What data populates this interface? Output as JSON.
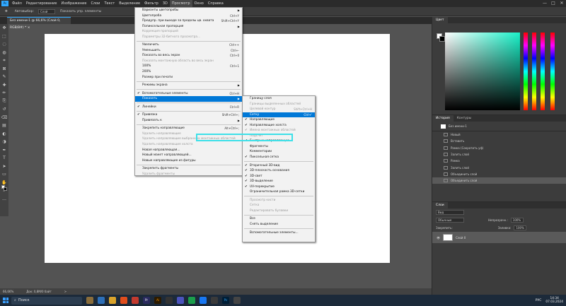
{
  "app": {
    "menubar": [
      "Файл",
      "Редактирование",
      "Изображение",
      "Слои",
      "Текст",
      "Выделение",
      "Фильтр",
      "3D",
      "Просмотр",
      "Окно",
      "Справка"
    ],
    "active_menu_index": 8,
    "window_controls": [
      "—",
      "□",
      "✕"
    ]
  },
  "options_bar": {
    "tool_label": "Автовыбор:",
    "select_value": "Слой",
    "show_controls": "Показать упр. элементы"
  },
  "document_tab": "Без имени-1 @ 66,6% (Слой 0, RGB/8#) * ×",
  "status_bar": {
    "zoom": "66,66%",
    "doc": "Док: 0,8М/0 байт",
    "arrow": ">"
  },
  "toolbar_icons": [
    "move-icon",
    "marquee-icon",
    "lasso-icon",
    "quick-select-icon",
    "crop-icon",
    "frame-icon",
    "eyedropper-icon",
    "healing-icon",
    "brush-icon",
    "stamp-icon",
    "history-brush-icon",
    "eraser-icon",
    "gradient-icon",
    "blur-icon",
    "dodge-icon",
    "pen-icon",
    "type-icon",
    "path-select-icon",
    "rectangle-icon",
    "hand-icon",
    "zoom-icon",
    "more-icon"
  ],
  "main_menu": [
    {
      "label": "Варианты цветопробы",
      "arrow": true
    },
    {
      "label": "Цветопроба",
      "shortcut": "Ctrl+Y"
    },
    {
      "label": "Предупр. при выходе за пределы цв. охвата",
      "shortcut": "Shift+Ctrl+Y"
    },
    {
      "label": "Попиксельная пропорция",
      "arrow": true
    },
    {
      "label": "Коррекция пропорций",
      "disabled": true
    },
    {
      "label": "Параметры 32-битного просмотра...",
      "disabled": true
    },
    {
      "sep": true
    },
    {
      "label": "Увеличить",
      "shortcut": "Ctrl++"
    },
    {
      "label": "Уменьшить",
      "shortcut": "Ctrl+-"
    },
    {
      "label": "Показать во весь экран",
      "shortcut": "Ctrl+0"
    },
    {
      "label": "Показать монтажную область во весь экран",
      "disabled": true
    },
    {
      "label": "100%",
      "shortcut": "Ctrl+1"
    },
    {
      "label": "200%"
    },
    {
      "label": "Размер при печати"
    },
    {
      "sep": true
    },
    {
      "label": "Режимы экрана",
      "arrow": true
    },
    {
      "sep": true
    },
    {
      "label": "Вспомогательные элементы",
      "shortcut": "Ctrl+H",
      "check": true
    },
    {
      "label": "Показать",
      "arrow": true,
      "highlight": true
    },
    {
      "sep": true
    },
    {
      "label": "Линейки",
      "shortcut": "Ctrl+R",
      "check": true
    },
    {
      "sep": true
    },
    {
      "label": "Привязка",
      "shortcut": "Shift+Ctrl+;",
      "check": true
    },
    {
      "label": "Привязать к",
      "arrow": true
    },
    {
      "sep": true
    },
    {
      "label": "Закрепить направляющие",
      "shortcut": "Alt+Ctrl+;"
    },
    {
      "label": "Удалить направляющие",
      "disabled": true
    },
    {
      "label": "Удалить направляющие выбранных монтажных областей",
      "disabled": true
    },
    {
      "label": "Удалить направляющие холста",
      "disabled": true
    },
    {
      "label": "Новая направляющая..."
    },
    {
      "label": "Новый макет направляющей..."
    },
    {
      "label": "Новые направляющие из фигуры"
    },
    {
      "sep": true
    },
    {
      "label": "Закрепить фрагменты"
    },
    {
      "label": "Удалить фрагменты",
      "disabled": true
    }
  ],
  "sub_menu": [
    {
      "label": "Границу слоя"
    },
    {
      "label": "Границы выделенных областей",
      "disabled": true
    },
    {
      "label": "Целевой контур",
      "shortcut": "Shift+Ctrl+H",
      "disabled": true
    },
    {
      "label": "Сетку",
      "shortcut": "Ctrl+'",
      "highlight": true
    },
    {
      "label": "Направляющие",
      "check": true
    },
    {
      "label": "Направляющие холста",
      "check": true
    },
    {
      "label": "Имена монтажных областей",
      "check": true,
      "disabled": true
    },
    {
      "label": "Подсчет",
      "disabled": true
    },
    {
      "label": "Быстрые направляющие",
      "check": true
    },
    {
      "label": "Фрагменты"
    },
    {
      "label": "Комментарии"
    },
    {
      "label": "Пиксельная сетка",
      "check": true
    },
    {
      "sep": true
    },
    {
      "label": "Вторичный 3D-вид",
      "check": true
    },
    {
      "label": "3D-плоскость основания",
      "check": true
    },
    {
      "label": "3D-свет",
      "check": true
    },
    {
      "label": "3D-выделение",
      "check": true
    },
    {
      "label": "UV-перекрытие",
      "check": true
    },
    {
      "label": "Ограничительная рамка 3D-сетки"
    },
    {
      "sep": true
    },
    {
      "label": "Просмотр кисти",
      "disabled": true
    },
    {
      "label": "Сетка",
      "disabled": true
    },
    {
      "label": "Редактировать булавки",
      "disabled": true
    },
    {
      "sep": true
    },
    {
      "label": "Все"
    },
    {
      "label": "Снять выделение"
    },
    {
      "sep": true
    },
    {
      "label": "Вспомогательные элементы..."
    }
  ],
  "color_panel": {
    "tab": "Цвет",
    "accent": "#19f2c9"
  },
  "history_panel": {
    "tabs": [
      "История",
      "Контуры"
    ],
    "snapshot": "Без имени-1",
    "items": [
      "Новый",
      "Вставить",
      "Рамка (Сократить уф)",
      "Залить слой",
      "Рамка",
      "Залить слой",
      "Объединить слой",
      "Объединить слой"
    ]
  },
  "layers_panel": {
    "tabs": [
      "Слои"
    ],
    "kind": "Вид",
    "blend_mode": "Обычные",
    "opacity_label": "Непрозрачн.:",
    "opacity": "100%",
    "lock_label": "Закрепить:",
    "fill_label": "Заливка:",
    "fill": "100%",
    "layer_name": "Слой 0"
  },
  "taskbar": {
    "search_placeholder": "Поиск",
    "tray_lang": "РУС",
    "time": "14:34",
    "date": "07.03.2024"
  }
}
